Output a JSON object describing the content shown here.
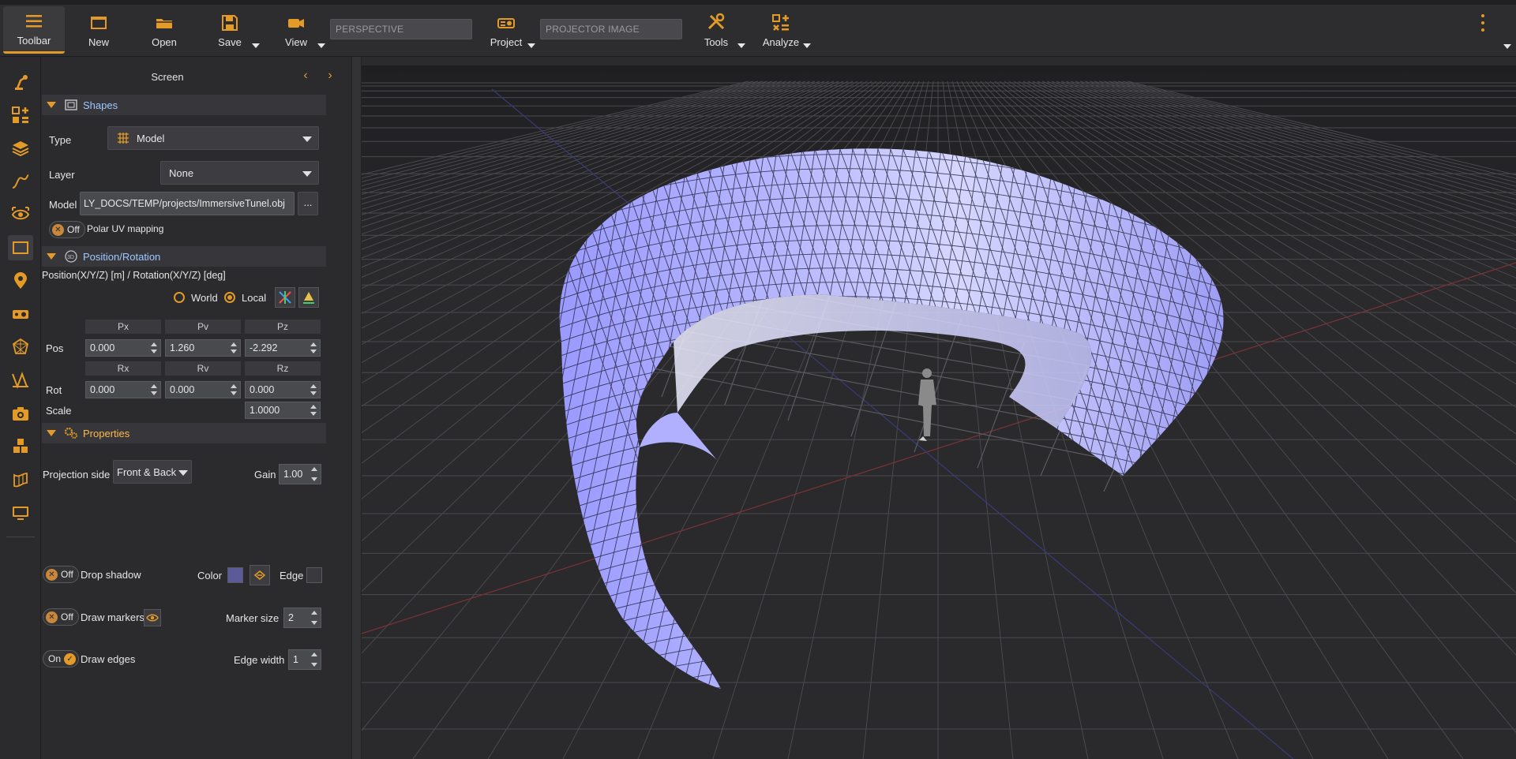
{
  "toolbar": {
    "items": [
      {
        "label": "Toolbar",
        "icon": "hamburger-icon"
      },
      {
        "label": "New",
        "icon": "new-window-icon"
      },
      {
        "label": "Open",
        "icon": "folder-icon"
      },
      {
        "label": "Save",
        "icon": "save-icon"
      },
      {
        "label": "View",
        "icon": "camera-icon"
      },
      {
        "label": "Project",
        "icon": "projector-icon"
      },
      {
        "label": "Tools",
        "icon": "tools-icon"
      },
      {
        "label": "Analyze",
        "icon": "analyze-icon"
      }
    ],
    "view_field": "PERSPECTIVE",
    "project_field": "PROJECTOR IMAGE",
    "accent": "#e39a26"
  },
  "panel": {
    "title": "Screen",
    "shapes": {
      "header": "Shapes",
      "type_label": "Type",
      "type_value": "Model",
      "layer_label": "Layer",
      "layer_value": "None",
      "model_label": "Model",
      "model_value": "LY_DOCS/TEMP/projects/ImmersiveTunel.obj",
      "browse": "...",
      "polar_toggle": "Off",
      "polar_label": "Polar UV mapping"
    },
    "position": {
      "header": "Position/Rotation",
      "caption": "Position(X/Y/Z) [m] / Rotation(X/Y/Z) [deg]",
      "world": "World",
      "local": "Local",
      "pos_headers": [
        "Px",
        "Pv",
        "Pz"
      ],
      "rot_headers": [
        "Rx",
        "Rv",
        "Rz"
      ],
      "pos_label": "Pos",
      "rot_label": "Rot",
      "scale_label": "Scale",
      "pos": [
        "0.000",
        "1.260",
        "-2.292"
      ],
      "rot": [
        "0.000",
        "0.000",
        "0.000"
      ],
      "scale": "1.0000"
    },
    "properties": {
      "header": "Properties",
      "projection_label": "Projection side",
      "projection_value": "Front & Back",
      "gain_label": "Gain",
      "gain_value": "1.00",
      "shadow_toggle": "Off",
      "shadow_label": "Drop shadow",
      "color_label": "Color",
      "edge_label": "Edge",
      "color_value": "#5b5b9a",
      "edge_value": "#3a3a3e",
      "markers_toggle": "Off",
      "markers_label": "Draw markers",
      "marker_size_label": "Marker size",
      "marker_size_value": "2",
      "edges_toggle": "On",
      "edges_label": "Draw edges",
      "edge_width_label": "Edge width",
      "edge_width_value": "1"
    }
  },
  "viewport": {
    "surface_color": "#a9a9ff",
    "grid_color": "#4a4a4e"
  }
}
